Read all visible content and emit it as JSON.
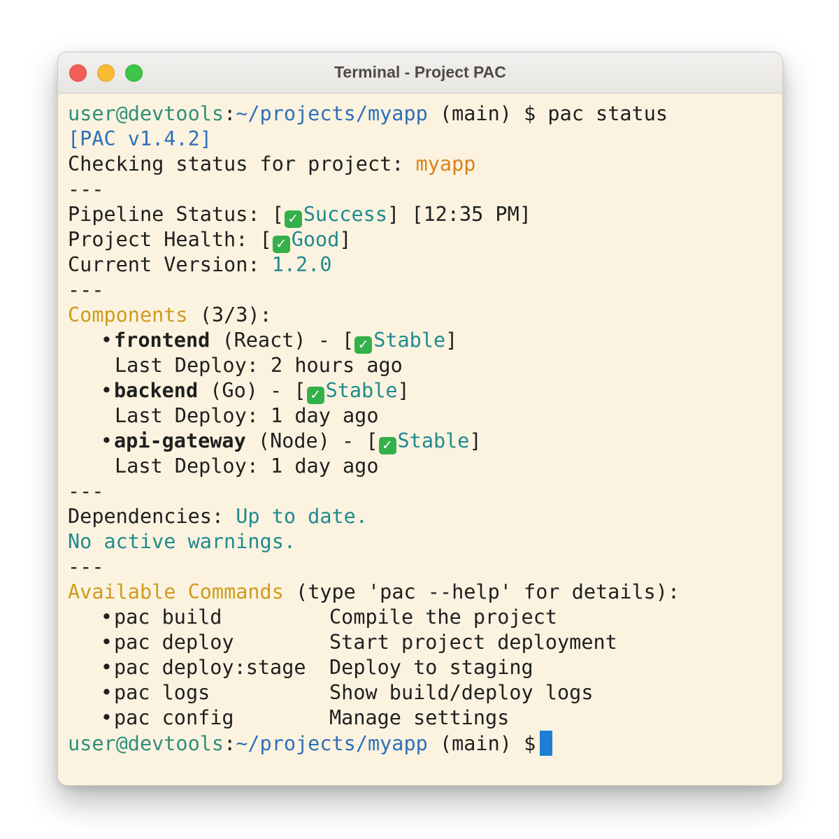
{
  "window": {
    "title": "Terminal - Project PAC"
  },
  "prompt": {
    "user_host": "user@devtools",
    "colon": ":",
    "path": "~/projects/myapp",
    "branch": "(main)",
    "symbol": "$"
  },
  "command": "pac status",
  "version_line": "[PAC v1.4.2]",
  "checking": {
    "label": "Checking status for project: ",
    "project": "myapp"
  },
  "separator": "---",
  "pipeline": {
    "label": "Pipeline Status: ",
    "status": "Success",
    "time": "[12:35 PM]"
  },
  "health": {
    "label": "Project Health: ",
    "status": "Good"
  },
  "current_version": {
    "label": "Current Version: ",
    "value": "1.2.0"
  },
  "components": {
    "heading": "Components",
    "count": " (3/3):",
    "items": [
      {
        "name": "frontend",
        "tech": " (React) - ",
        "status": "Stable",
        "deploy": "Last Deploy: 2 hours ago"
      },
      {
        "name": "backend",
        "tech": " (Go) - ",
        "status": "Stable",
        "deploy": "Last Deploy: 1 day ago"
      },
      {
        "name": "api-gateway",
        "tech": " (Node) - ",
        "status": "Stable",
        "deploy": "Last Deploy: 1 day ago"
      }
    ]
  },
  "dependencies": {
    "label": "Dependencies: ",
    "value": "Up to date."
  },
  "warnings": "No active warnings.",
  "commands": {
    "heading_1": "Available",
    "heading_2": "Commands",
    "hint": " (type 'pac --help' for details):",
    "items": [
      {
        "name": "pac build",
        "desc": "Compile the project"
      },
      {
        "name": "pac deploy",
        "desc": "Start project deployment"
      },
      {
        "name": "pac deploy:stage",
        "desc": "Deploy to staging"
      },
      {
        "name": "pac logs",
        "desc": "Show build/deploy logs"
      },
      {
        "name": "pac config",
        "desc": "Manage settings"
      }
    ]
  },
  "symbols": {
    "bullet": "•",
    "check": "✓",
    "open_bracket": "[",
    "close_bracket": "]"
  },
  "colors": {
    "prompt_user": "#2f8f7a",
    "prompt_path": "#2f6fb8",
    "project": "#d9821d",
    "heading": "#cf9b1c",
    "status": "#1f8a8e",
    "check": "#34b04a",
    "cursor": "#1e7fd2"
  }
}
